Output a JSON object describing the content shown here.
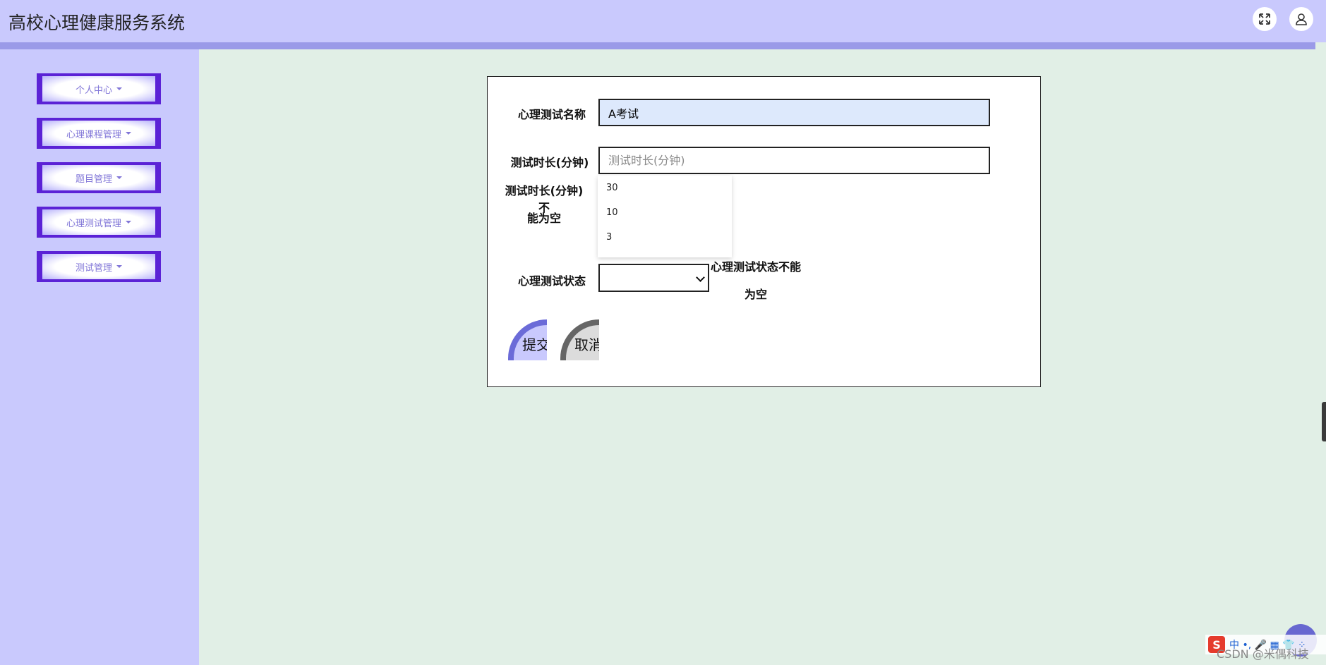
{
  "header": {
    "title": "高校心理健康服务系统",
    "icons": [
      "fullscreen-icon",
      "user-icon"
    ]
  },
  "sidebar": {
    "items": [
      {
        "label": "个人中心"
      },
      {
        "label": "心理课程管理"
      },
      {
        "label": "题目管理"
      },
      {
        "label": "心理测试管理"
      },
      {
        "label": "测试管理"
      }
    ]
  },
  "form": {
    "name_label": "心理测试名称",
    "name_value": "A考试",
    "duration_label": "测试时长(分钟)",
    "duration_placeholder": "测试时长(分钟)",
    "duration_error_line1": "测试时长(分钟)不",
    "duration_error_line2": "能为空",
    "duration_suggestions": [
      "30",
      "10",
      "3"
    ],
    "status_label": "心理测试状态",
    "status_value": "",
    "status_error_line1": "心理测试状态不能",
    "status_error_line2": "为空",
    "submit_label": "提交",
    "cancel_label": "取消"
  },
  "overlay": {
    "ime_logo": "S",
    "ime_text": "中 •, 🎤 ▦ 👕 ⁘",
    "watermark": "CSDN @米偶科技"
  },
  "colors": {
    "topbar": "#c9c9fd",
    "sidebar": "#c9c9fd",
    "menu_border": "#5b22d6",
    "content_bg": "#e1efe6",
    "input_filled": "#dde9fc"
  }
}
